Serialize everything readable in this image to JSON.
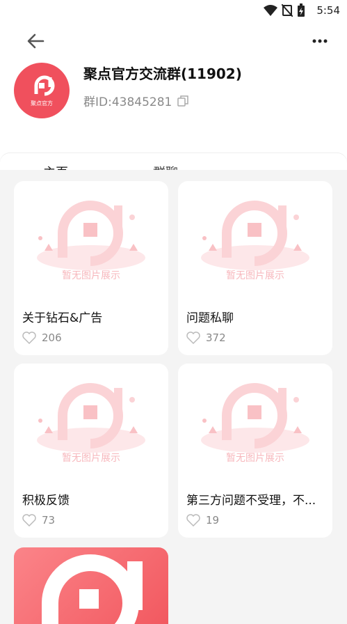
{
  "status_bar": {
    "time": "5:54",
    "icons": [
      "wifi-icon",
      "no-sim-icon",
      "battery-charging-icon"
    ]
  },
  "header": {
    "back_icon": "arrow-left-icon",
    "more_icon": "more-dots-icon",
    "avatar_text": "聚点官方",
    "group_name": "聚点官方交流群(11902)",
    "group_id": "群ID:43845281",
    "copy_icon": "copy-icon"
  },
  "tabs": [
    {
      "label": "主页",
      "active": true
    },
    {
      "label": "群聊",
      "active": false
    }
  ],
  "placeholder_text": "暂无图片展示",
  "cards": [
    {
      "title": "关于钻石&广告",
      "likes": "206"
    },
    {
      "title": "问题私聊",
      "likes": "372"
    },
    {
      "title": "积极反馈",
      "likes": "73"
    },
    {
      "title": "第三方问题不受理，不...",
      "likes": "19"
    }
  ],
  "colors": {
    "brand_red": "#f0505d",
    "placeholder_pink": "#f7b7bc",
    "background": "#f4f4f4"
  }
}
